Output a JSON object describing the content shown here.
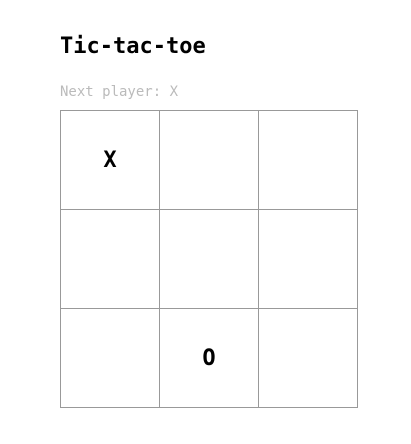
{
  "title": "Tic-tac-toe",
  "status": "Next player: X",
  "board": [
    "X",
    "",
    "",
    "",
    "",
    "",
    "",
    "O",
    ""
  ]
}
